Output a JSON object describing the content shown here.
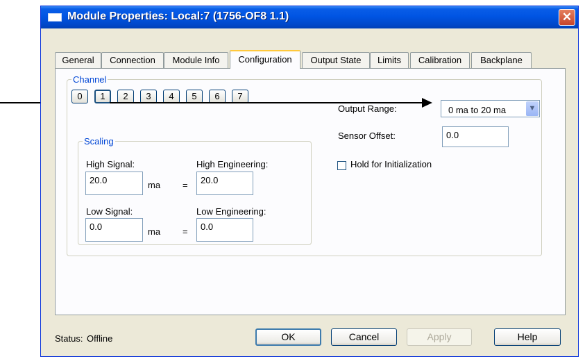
{
  "window": {
    "title": "Module Properties: Local:7 (1756-OF8 1.1)",
    "close_label": "✕"
  },
  "tabs": [
    {
      "label": "General"
    },
    {
      "label": "Connection"
    },
    {
      "label": "Module Info"
    },
    {
      "label": "Configuration",
      "active": true
    },
    {
      "label": "Output State"
    },
    {
      "label": "Limits"
    },
    {
      "label": "Calibration"
    },
    {
      "label": "Backplane"
    }
  ],
  "channel": {
    "legend": "Channel",
    "buttons": [
      "0",
      "1",
      "2",
      "3",
      "4",
      "5",
      "6",
      "7"
    ],
    "selected": "1"
  },
  "output_range": {
    "label": "Output Range:",
    "value": "0 ma to 20 ma",
    "arrow": "▼"
  },
  "sensor_offset": {
    "label": "Sensor Offset:",
    "value": "0.0"
  },
  "hold_for_init": {
    "label": "Hold for Initialization",
    "checked": false
  },
  "scaling": {
    "legend": "Scaling",
    "high_signal_label": "High Signal:",
    "high_signal_value": "20.0",
    "high_signal_unit": "ma",
    "high_eng_label": "High Engineering:",
    "high_eng_value": "20.0",
    "low_signal_label": "Low Signal:",
    "low_signal_value": "0.0",
    "low_signal_unit": "ma",
    "low_eng_label": "Low Engineering:",
    "low_eng_value": "0.0",
    "equals": "="
  },
  "footer": {
    "status_label": "Status:",
    "status_value": "Offline",
    "ok": "OK",
    "cancel": "Cancel",
    "apply": "Apply",
    "help": "Help"
  }
}
